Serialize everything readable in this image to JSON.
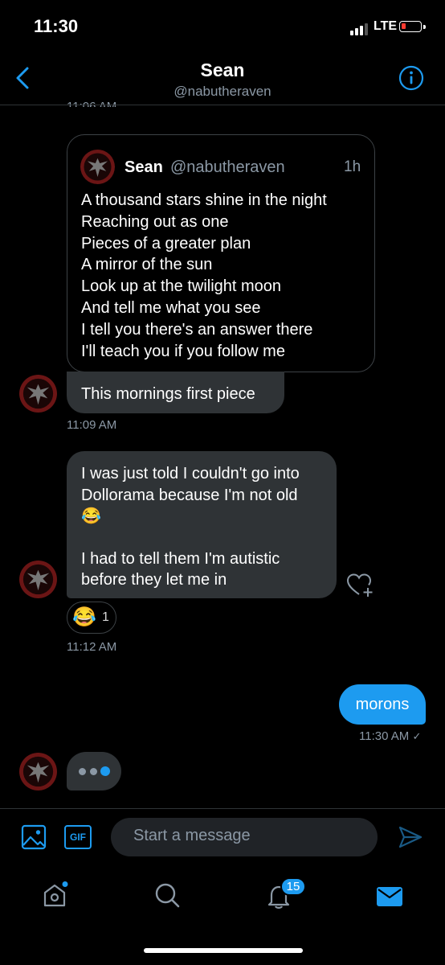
{
  "status": {
    "time": "11:30",
    "network": "LTE"
  },
  "header": {
    "title": "Sean",
    "handle": "@nabutheraven"
  },
  "timestamps": {
    "top_partial": "11:06 AM",
    "after_quote": "11:09 AM",
    "after_dollorama": "11:12 AM",
    "after_morons": "11:30 AM"
  },
  "quote_tweet": {
    "name": "Sean",
    "handle": "@nabutheraven",
    "age": "1h",
    "lines": [
      "A thousand stars shine in the night",
      "Reaching out as one",
      "Pieces of a greater plan",
      "A mirror of the sun",
      "Look up at the twilight moon",
      "And tell me what you see",
      "I tell you there's an answer there",
      "I'll teach you if you follow me"
    ]
  },
  "messages": {
    "first_piece": "This mornings first piece",
    "dollorama_line1": "I was just told I couldn't go into",
    "dollorama_line2": "Dollorama because I'm not old",
    "dollorama_emoji": "😂",
    "dollorama_line3": "I had to tell them I'm autistic",
    "dollorama_line4": "before they let me in",
    "reaction_emoji": "😂",
    "reaction_count": "1",
    "morons": "morons",
    "read_mark": "✓"
  },
  "composer": {
    "placeholder": "Start a message",
    "gif_label": "GIF"
  },
  "tabs": {
    "notifications_badge": "15"
  },
  "colors": {
    "accent": "#1d9bf0",
    "incoming_bubble": "#2f3336",
    "muted": "#8b98a5"
  }
}
